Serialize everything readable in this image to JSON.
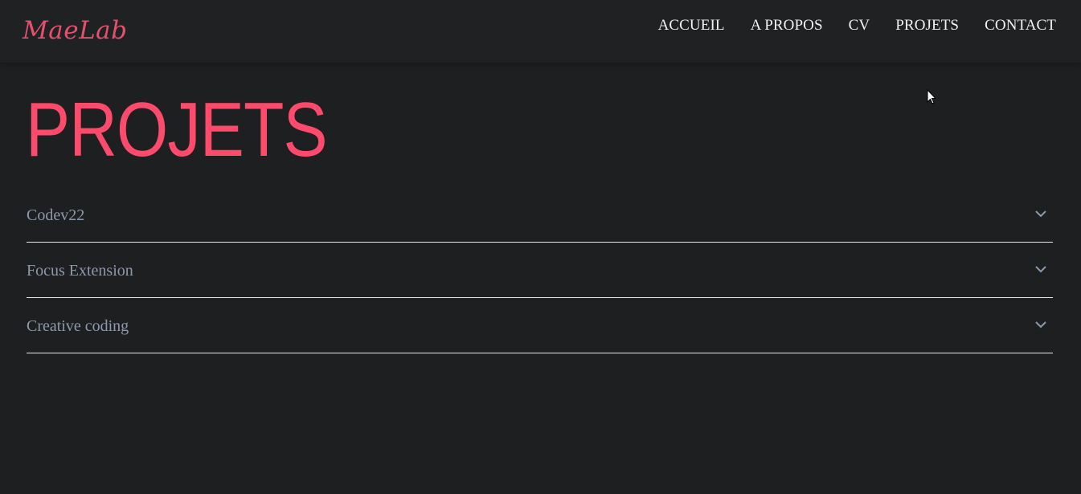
{
  "header": {
    "logo_text": "MaeLab",
    "nav": [
      {
        "label": "ACCUEIL"
      },
      {
        "label": "A PROPOS"
      },
      {
        "label": "CV"
      },
      {
        "label": "PROJETS"
      },
      {
        "label": "CONTACT"
      }
    ]
  },
  "main": {
    "title": "PROJETS",
    "projects": [
      {
        "label": "Codev22",
        "icon": "chevron-down-icon"
      },
      {
        "label": "Focus Extension",
        "icon": "chevron-down-icon"
      },
      {
        "label": "Creative coding",
        "icon": "chevron-down-icon"
      }
    ]
  },
  "colors": {
    "background": "#1e1f21",
    "header_bg": "#202123",
    "accent": "#ff4b6b",
    "nav_text": "#f2f2f2",
    "item_text": "#8e99ad",
    "divider": "#e8e8e8"
  }
}
